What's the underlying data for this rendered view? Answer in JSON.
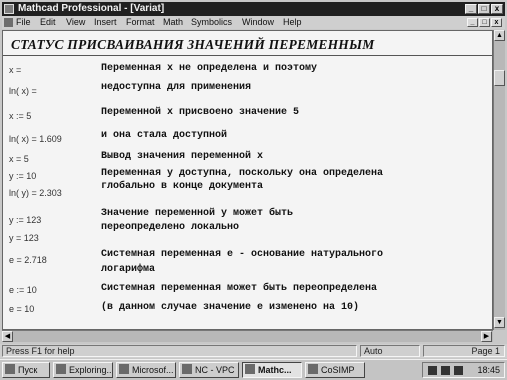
{
  "window": {
    "title": "Mathcad Professional - [Variat]",
    "controls": [
      "_",
      "□",
      "x"
    ]
  },
  "menu": {
    "items": [
      "File",
      "Edit",
      "View",
      "Insert",
      "Format",
      "Math",
      "Symbolics",
      "Window",
      "Help"
    ],
    "doc_controls": [
      "_",
      "□",
      "x"
    ]
  },
  "document": {
    "heading": "СТАТУС ПРИСВАИВАНИЯ ЗНАЧЕНИЙ ПЕРЕМЕННЫМ",
    "expressions": [
      "x =",
      "ln( x) =",
      "x := 5",
      "ln( x) = 1.609",
      "x = 5",
      "y := 10",
      "ln( y) = 2.303",
      "y := 123",
      "y = 123",
      "e = 2.718",
      "e := 10",
      "e = 10"
    ],
    "descriptions": [
      "Переменная х не определена и поэтому",
      "недоступна для применения",
      "Переменной х присвоено значение 5",
      "и она стала доступной",
      "Вывод значения переменной х",
      "Переменная у доступна, поскольку она определена",
      "глобально в конце документа",
      "Значение переменной у может быть",
      "переопределено локально",
      "Системная переменная е - основание натурального",
      "логарифма",
      "Системная переменная может быть переопределена",
      "(в данном случае значение е изменено на 10)"
    ]
  },
  "status": {
    "help": "Press F1 for help",
    "mode": "Auto",
    "page": "Page 1"
  },
  "taskbar": {
    "start": "Пуск",
    "tasks": [
      "Exploring...",
      "Microsof...",
      "NC - VPC",
      "Mathc...",
      "CoSIMP"
    ],
    "clock": "18:45"
  }
}
